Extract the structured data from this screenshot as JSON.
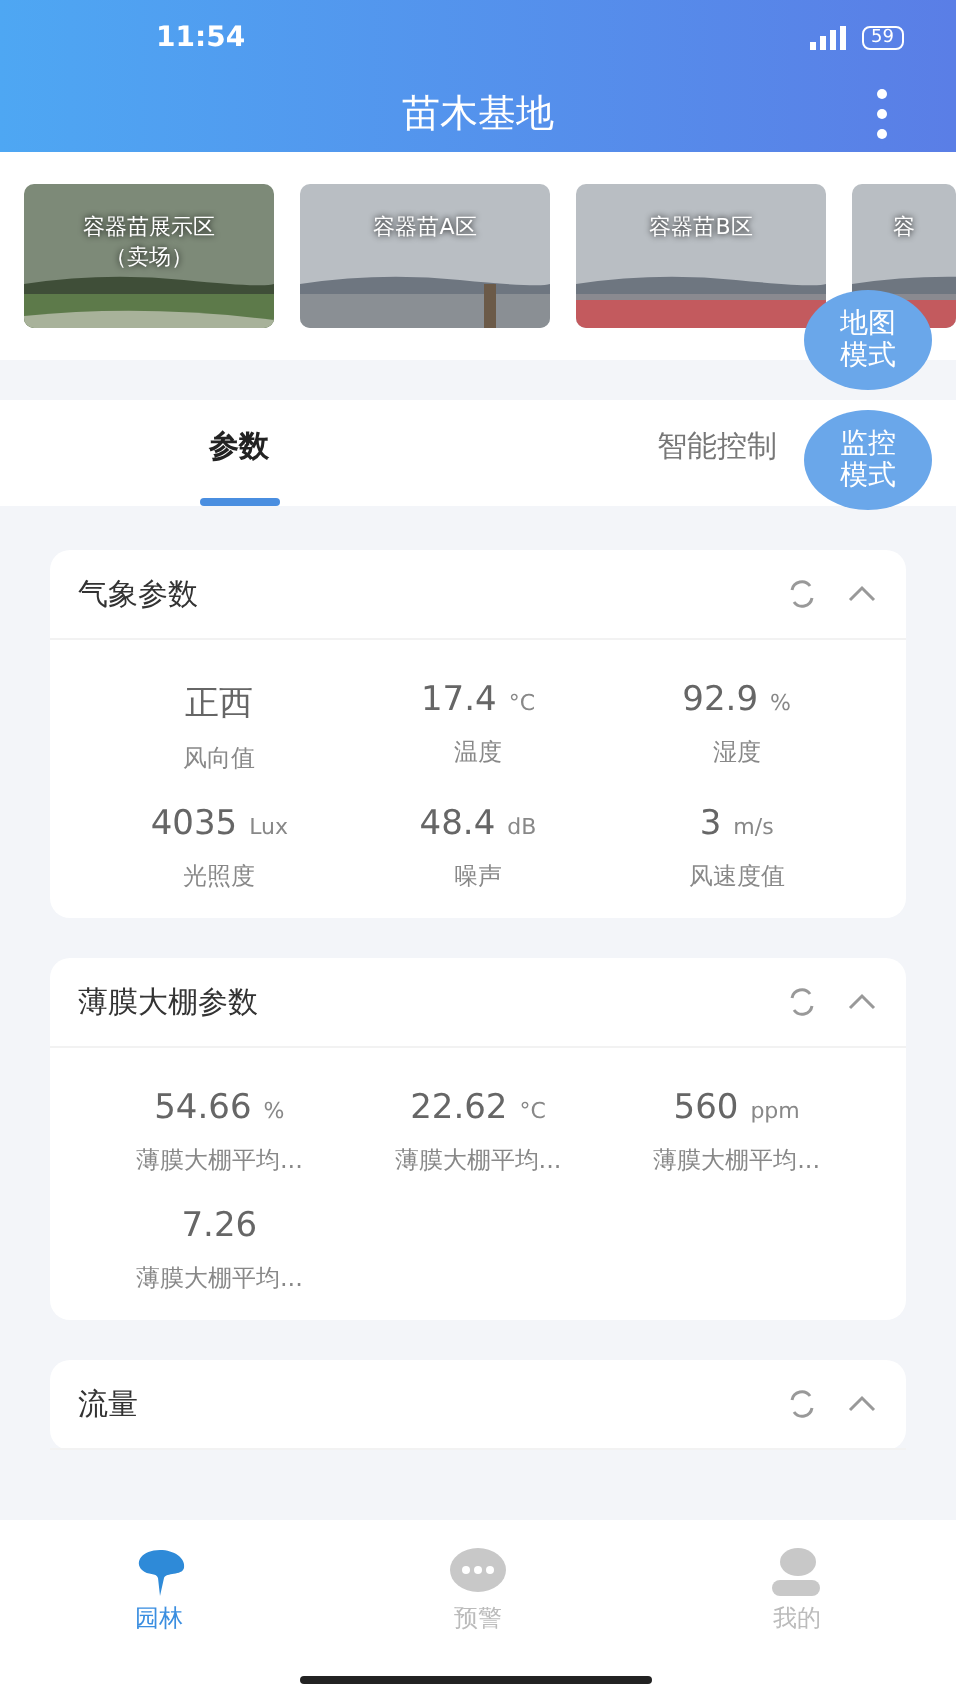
{
  "status_bar": {
    "time": "11:54",
    "battery": "59"
  },
  "header": {
    "title": "苗木基地"
  },
  "cameras": [
    {
      "label": "容器苗展示区（卖场）",
      "kind": "picture"
    },
    {
      "label": "容器苗A区",
      "kind": "picture"
    },
    {
      "label": "容器苗B区",
      "kind": "picture"
    },
    {
      "label": "容",
      "kind": "picture"
    }
  ],
  "floating_buttons": [
    "地图模式",
    "监控模式"
  ],
  "tabs": [
    {
      "label": "参数",
      "selected": true
    },
    {
      "label": "智能控制",
      "selected": false
    }
  ],
  "panels": [
    {
      "title": "气象参数",
      "expanded": true,
      "items": [
        {
          "value": "正西",
          "label": "风向值"
        },
        {
          "value": "17.4",
          "unit": "°C",
          "label": "温度"
        },
        {
          "value": "92.9",
          "unit": "%",
          "label": "湿度"
        },
        {
          "value": "4035",
          "unit": "Lux",
          "label": "光照度"
        },
        {
          "value": "48.4",
          "unit": "dB",
          "label": "噪声"
        },
        {
          "value": "3",
          "unit": "m/s",
          "label": "风速度值"
        }
      ]
    },
    {
      "title": "薄膜大棚参数",
      "expanded": true,
      "items": [
        {
          "value": "54.66",
          "unit": "%",
          "label": "薄膜大棚平均..."
        },
        {
          "value": "22.62",
          "unit": "°C",
          "label": "薄膜大棚平均..."
        },
        {
          "value": "560",
          "unit": "ppm",
          "label": "薄膜大棚平均..."
        },
        {
          "value": "7.26",
          "label": "薄膜大棚平均..."
        }
      ]
    },
    {
      "title": "流量",
      "expanded": true
    }
  ],
  "bottom_nav": [
    {
      "label": "园林",
      "selected": true,
      "kind": "tree"
    },
    {
      "label": "预警",
      "selected": false,
      "kind": "chat"
    },
    {
      "label": "我的",
      "selected": false,
      "kind": "user"
    }
  ]
}
